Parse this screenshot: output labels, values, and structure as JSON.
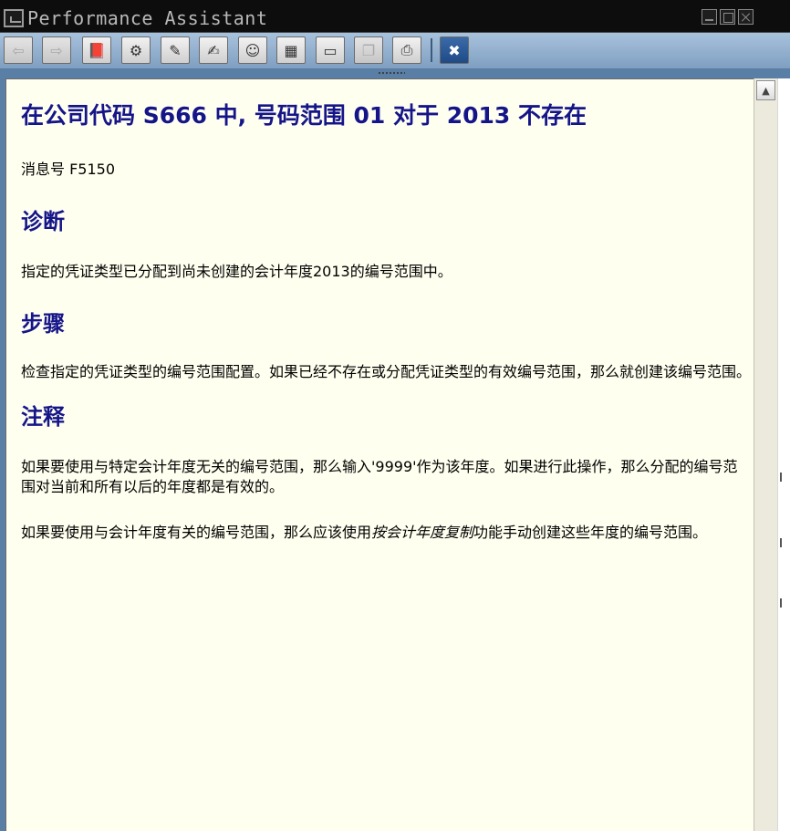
{
  "window": {
    "title": "Performance Assistant"
  },
  "toolbar": {
    "buttons": [
      {
        "icon": "back-arrow-icon",
        "glyph": "⇦",
        "enabled": false
      },
      {
        "icon": "forward-arrow-icon",
        "glyph": "⇨",
        "enabled": false
      },
      {
        "icon": "book-icon",
        "glyph": "📕",
        "enabled": true
      },
      {
        "icon": "technical-info-icon",
        "glyph": "⚙",
        "enabled": true
      },
      {
        "icon": "edit-icon",
        "glyph": "✎",
        "enabled": true
      },
      {
        "icon": "edit-text-icon",
        "glyph": "✍",
        "enabled": true
      },
      {
        "icon": "user-settings-icon",
        "glyph": "☺",
        "enabled": true
      },
      {
        "icon": "table-icon",
        "glyph": "▦",
        "enabled": true
      },
      {
        "icon": "display-icon",
        "glyph": "▭",
        "enabled": true
      },
      {
        "icon": "copy-icon",
        "glyph": "❐",
        "enabled": false
      },
      {
        "icon": "print-icon",
        "glyph": "⎙",
        "enabled": true
      },
      {
        "icon": "close-icon",
        "glyph": "✖",
        "enabled": true
      }
    ]
  },
  "scroll": {
    "up_glyph": "▲"
  },
  "doc": {
    "title": "在公司代码  S666 中, 号码范围  01 对于  2013 不存在",
    "message_number": "消息号 F5150",
    "diagnosis_heading": "诊断",
    "diagnosis_text": "指定的凭证类型已分配到尚未创建的会计年度2013的编号范围中。",
    "procedure_heading": "步骤",
    "procedure_text": "检查指定的凭证类型的编号范围配置。如果已经不存在或分配凭证类型的有效编号范围，那么就创建该编号范围。",
    "note_heading": "注释",
    "note_text_1": "如果要使用与特定会计年度无关的编号范围，那么输入'9999'作为该年度。如果进行此操作，那么分配的编号范围对当前和所有以后的年度都是有效的。",
    "note_text_2_before": "如果要使用与会计年度有关的编号范围，那么应该使用",
    "note_text_2_italic": "按会计年度复制",
    "note_text_2_after": "功能手动创建这些年度的编号范围。"
  }
}
